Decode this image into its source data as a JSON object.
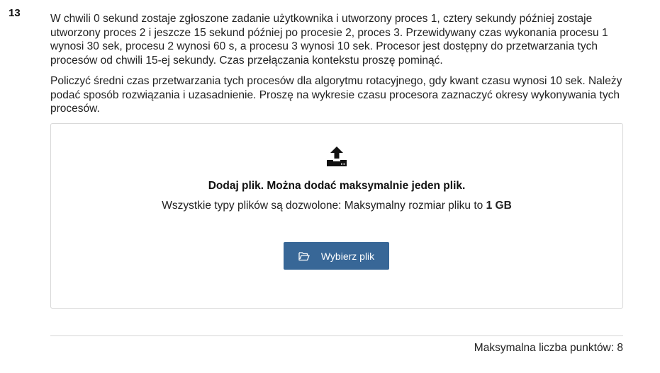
{
  "question": {
    "number": "13",
    "paragraph1": "W chwili 0 sekund zostaje zgłoszone zadanie użytkownika i utworzony proces 1, cztery sekundy później zostaje utworzony proces 2 i jeszcze 15 sekund później po procesie 2,  proces 3. Przewidywany czas wykonania procesu 1 wynosi 30 sek, procesu 2 wynosi 60 s, a procesu 3 wynosi 10 sek. Procesor jest dostępny do przetwarzania tych procesów od chwili 15-ej sekundy. Czas przełączania kontekstu proszę pominąć.",
    "paragraph2": "Policzyć średni czas przetwarzania tych procesów dla algorytmu rotacyjnego, gdy kwant czasu wynosi 10 sek. Należy podać sposób rozwiązania i uzasadnienie. Proszę na wykresie czasu procesora zaznaczyć okresy wykonywania tych procesów."
  },
  "upload": {
    "icon": "upload-icon",
    "title": "Dodaj plik. Można dodać maksymalnie jeden plik.",
    "subtitle_prefix": "Wszystkie typy plików są dozwolone: Maksymalny rozmiar pliku to ",
    "max_size": "1 GB",
    "button_icon": "folder-open-icon",
    "button_label": "Wybierz plik",
    "button_color": "#386797"
  },
  "footer": {
    "max_points": "Maksymalna liczba punktów: 8"
  }
}
